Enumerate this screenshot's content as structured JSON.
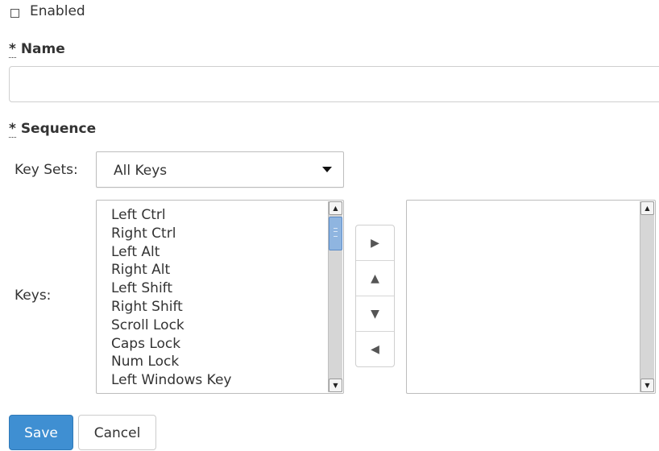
{
  "enabled": {
    "label": "Enabled",
    "checked": false
  },
  "name": {
    "required_mark": "*",
    "label": "Name",
    "value": ""
  },
  "sequence": {
    "required_mark": "*",
    "label": "Sequence",
    "key_sets_label": "Key Sets:",
    "key_sets_selected": "All Keys",
    "keys_label": "Keys:",
    "available_keys": [
      "Left Ctrl",
      "Right Ctrl",
      "Left Alt",
      "Right Alt",
      "Left Shift",
      "Right Shift",
      "Scroll Lock",
      "Caps Lock",
      "Num Lock",
      "Left Windows Key"
    ],
    "selected_keys": [],
    "controls": {
      "add_icon": "triangle-right-icon",
      "up_icon": "triangle-up-icon",
      "down_icon": "triangle-down-icon",
      "remove_icon": "triangle-left-icon"
    }
  },
  "actions": {
    "save_label": "Save",
    "cancel_label": "Cancel"
  },
  "colors": {
    "primary": "#3f8fd2",
    "scroll_thumb": "#8fb5e0"
  }
}
